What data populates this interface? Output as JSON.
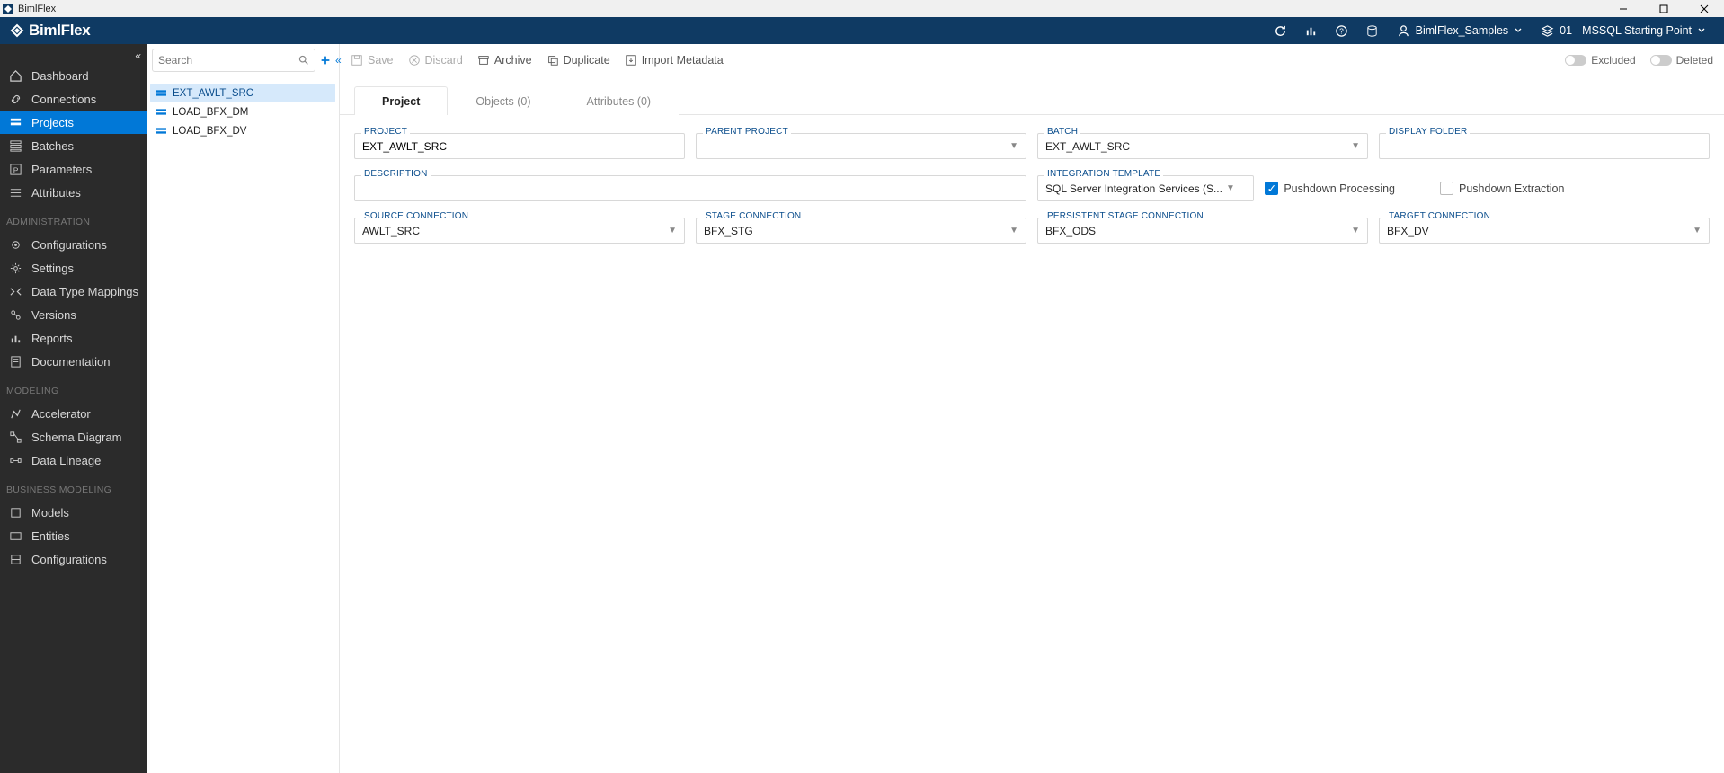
{
  "window_title": "BimlFlex",
  "logo_text": "BimlFlex",
  "header": {
    "customer": "BimlFlex_Samples",
    "version": "01 - MSSQL Starting Point"
  },
  "sidebar": {
    "items": [
      "Dashboard",
      "Connections",
      "Projects",
      "Batches",
      "Parameters",
      "Attributes"
    ],
    "admin_header": "ADMINISTRATION",
    "admin_items": [
      "Configurations",
      "Settings",
      "Data Type Mappings",
      "Versions",
      "Reports",
      "Documentation"
    ],
    "modeling_header": "MODELING",
    "modeling_items": [
      "Accelerator",
      "Schema Diagram",
      "Data Lineage"
    ],
    "business_header": "BUSINESS MODELING",
    "business_items": [
      "Models",
      "Entities",
      "Configurations"
    ]
  },
  "mid": {
    "search_ph": "Search",
    "items": [
      "EXT_AWLT_SRC",
      "LOAD_BFX_DM",
      "LOAD_BFX_DV"
    ]
  },
  "toolbar": {
    "save": "Save",
    "discard": "Discard",
    "archive": "Archive",
    "duplicate": "Duplicate",
    "import": "Import Metadata",
    "excluded": "Excluded",
    "deleted": "Deleted"
  },
  "tabs": [
    "Project",
    "Objects (0)",
    "Attributes (0)"
  ],
  "form": {
    "labels": {
      "project": "PROJECT",
      "parent": "PARENT PROJECT",
      "batch": "BATCH",
      "display_folder": "DISPLAY FOLDER",
      "description": "DESCRIPTION",
      "integration": "INTEGRATION TEMPLATE",
      "pushdown_proc": "Pushdown Processing",
      "pushdown_ext": "Pushdown Extraction",
      "source_conn": "SOURCE CONNECTION",
      "stage_conn": "STAGE CONNECTION",
      "persist_conn": "PERSISTENT STAGE CONNECTION",
      "target_conn": "TARGET CONNECTION"
    },
    "values": {
      "project": "EXT_AWLT_SRC",
      "parent": "",
      "batch": "EXT_AWLT_SRC",
      "display_folder": "",
      "description": "",
      "integration": "SQL Server Integration Services (S...",
      "source_conn": "AWLT_SRC",
      "stage_conn": "BFX_STG",
      "persist_conn": "BFX_ODS",
      "target_conn": "BFX_DV"
    }
  }
}
